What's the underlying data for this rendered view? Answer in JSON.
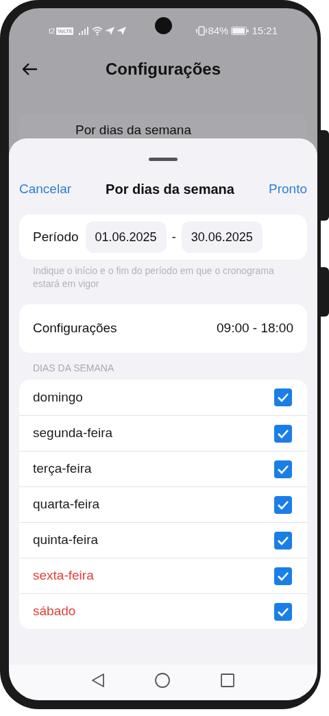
{
  "status_bar": {
    "left_text": "t2",
    "volte": "VoLTE",
    "battery": "84%",
    "time": "15:21"
  },
  "header": {
    "title": "Configurações"
  },
  "background_card": {
    "title": "Por dias da semana"
  },
  "sheet": {
    "cancel": "Cancelar",
    "title": "Por dias da semana",
    "done": "Pronto",
    "period": {
      "label": "Período",
      "start": "01.06.2025",
      "separator": "-",
      "end": "30.06.2025"
    },
    "period_hint": "Indique o início e o fim do período em que o cronograma estará em vigor",
    "settings": {
      "label": "Configurações",
      "value": "09:00 - 18:00"
    },
    "days_heading": "DIAS DA SEMANA",
    "days": [
      {
        "name": "domingo",
        "checked": true,
        "color": "#1c1c1e"
      },
      {
        "name": "segunda-feira",
        "checked": true,
        "color": "#1c1c1e"
      },
      {
        "name": "terça-feira",
        "checked": true,
        "color": "#1c1c1e"
      },
      {
        "name": "quarta-feira",
        "checked": true,
        "color": "#1c1c1e"
      },
      {
        "name": "quinta-feira",
        "checked": true,
        "color": "#1c1c1e"
      },
      {
        "name": "sexta-feira",
        "checked": true,
        "color": "#e0413a"
      },
      {
        "name": "sábado",
        "checked": true,
        "color": "#e0413a"
      }
    ]
  }
}
